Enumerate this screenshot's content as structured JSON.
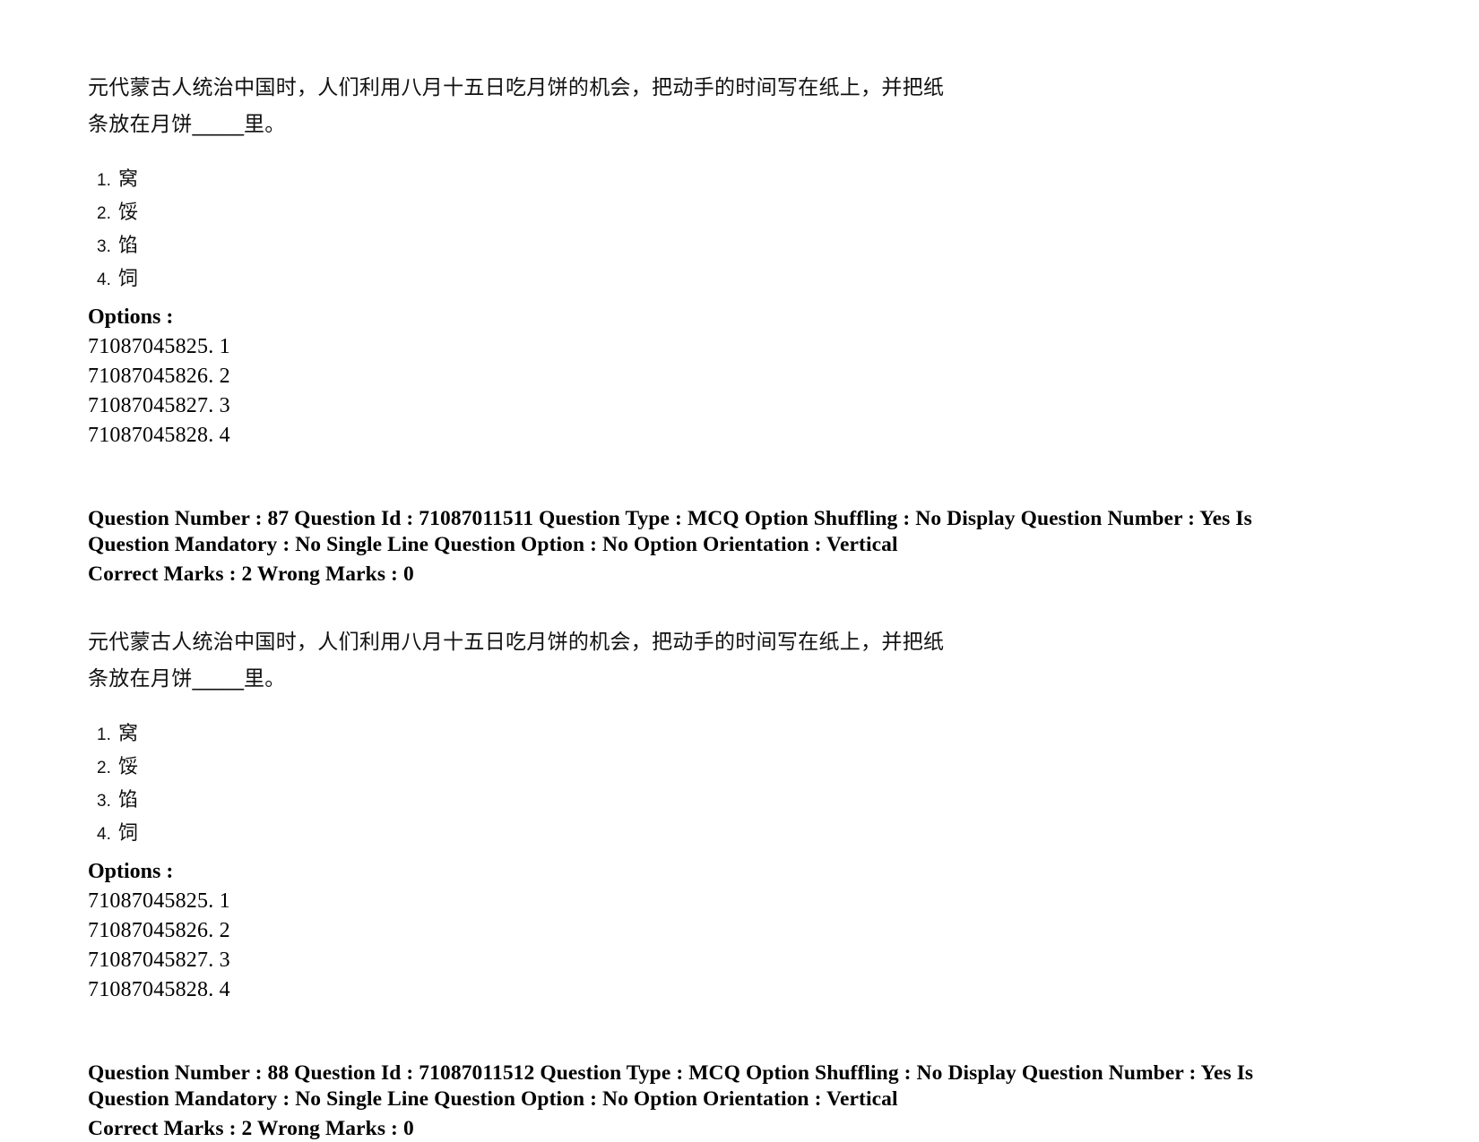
{
  "document": {
    "page_background": "#ffffff",
    "text_color": "#000000"
  },
  "blocks": [
    {
      "stem_line1": "元代蒙古人统治中国时，人们利用八月十五日吃月饼的机会，把动手的时间写在纸上，并把纸",
      "stem_line2_prefix": "条放在月饼",
      "stem_blank": "_____",
      "stem_line2_suffix": "里。",
      "choices": [
        {
          "num": "1.",
          "text": "窝"
        },
        {
          "num": "2.",
          "text": "馁"
        },
        {
          "num": "3.",
          "text": "馅"
        },
        {
          "num": "4.",
          "text": "饲"
        }
      ],
      "options_label": "Options :",
      "option_ids": [
        "71087045825. 1",
        "71087045826. 2",
        "71087045827. 3",
        "71087045828. 4"
      ]
    },
    {
      "stem_line1": "元代蒙古人统治中国时，人们利用八月十五日吃月饼的机会，把动手的时间写在纸上，并把纸",
      "stem_line2_prefix": "条放在月饼",
      "stem_blank": "_____",
      "stem_line2_suffix": "里。",
      "choices": [
        {
          "num": "1.",
          "text": "窝"
        },
        {
          "num": "2.",
          "text": "馁"
        },
        {
          "num": "3.",
          "text": "馅"
        },
        {
          "num": "4.",
          "text": "饲"
        }
      ],
      "options_label": "Options :",
      "option_ids": [
        "71087045825. 1",
        "71087045826. 2",
        "71087045827. 3",
        "71087045828. 4"
      ]
    }
  ],
  "question_headers": [
    {
      "line1": "Question Number : 87 Question Id : 71087011511 Question Type : MCQ Option Shuffling : No Display Question Number : Yes Is",
      "line2": "Question Mandatory : No Single Line Question Option : No Option Orientation : Vertical",
      "marks": "Correct Marks : 2 Wrong Marks : 0",
      "question_number": "87",
      "question_id": "71087011511",
      "question_type": "MCQ",
      "option_shuffling": "No",
      "display_question_number": "Yes",
      "is_question_mandatory": "No",
      "single_line_question_option": "No",
      "option_orientation": "Vertical",
      "correct_marks": "2",
      "wrong_marks": "0"
    },
    {
      "line1": "Question Number : 88 Question Id : 71087011512 Question Type : MCQ Option Shuffling : No Display Question Number : Yes Is",
      "line2": "Question Mandatory : No Single Line Question Option : No Option Orientation : Vertical",
      "marks": "Correct Marks : 2 Wrong Marks : 0",
      "question_number": "88",
      "question_id": "71087011512",
      "question_type": "MCQ",
      "option_shuffling": "No",
      "display_question_number": "Yes",
      "is_question_mandatory": "No",
      "single_line_question_option": "No",
      "option_orientation": "Vertical",
      "correct_marks": "2",
      "wrong_marks": "0"
    }
  ]
}
